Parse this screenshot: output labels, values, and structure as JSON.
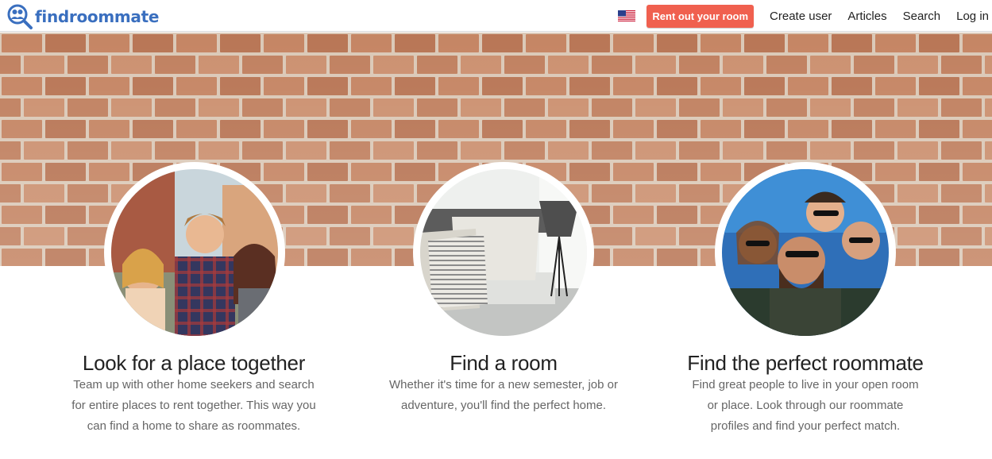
{
  "header": {
    "logo_text": "findroommate",
    "flag_icon": "us-flag-icon",
    "rent_button": "Rent out your room",
    "nav": [
      "Create user",
      "Articles",
      "Search",
      "Log in"
    ]
  },
  "features": [
    {
      "title": "Look for a place together",
      "lines": [
        "Team up with other home seekers and search",
        "for entire places to rent together. This way you",
        "can find a home to share as roommates."
      ]
    },
    {
      "title": "Find a room",
      "lines": [
        "Whether it's time for a new semester, job or",
        "adventure, you'll find the perfect home."
      ]
    },
    {
      "title": "Find the perfect roommate",
      "lines": [
        "Find great people to live in your open room",
        "or place. Look through our roommate",
        "profiles and find your perfect match."
      ]
    }
  ],
  "colors": {
    "brand": "#3a6fbf",
    "accent": "#f0604f",
    "brick": "#b5744f"
  }
}
